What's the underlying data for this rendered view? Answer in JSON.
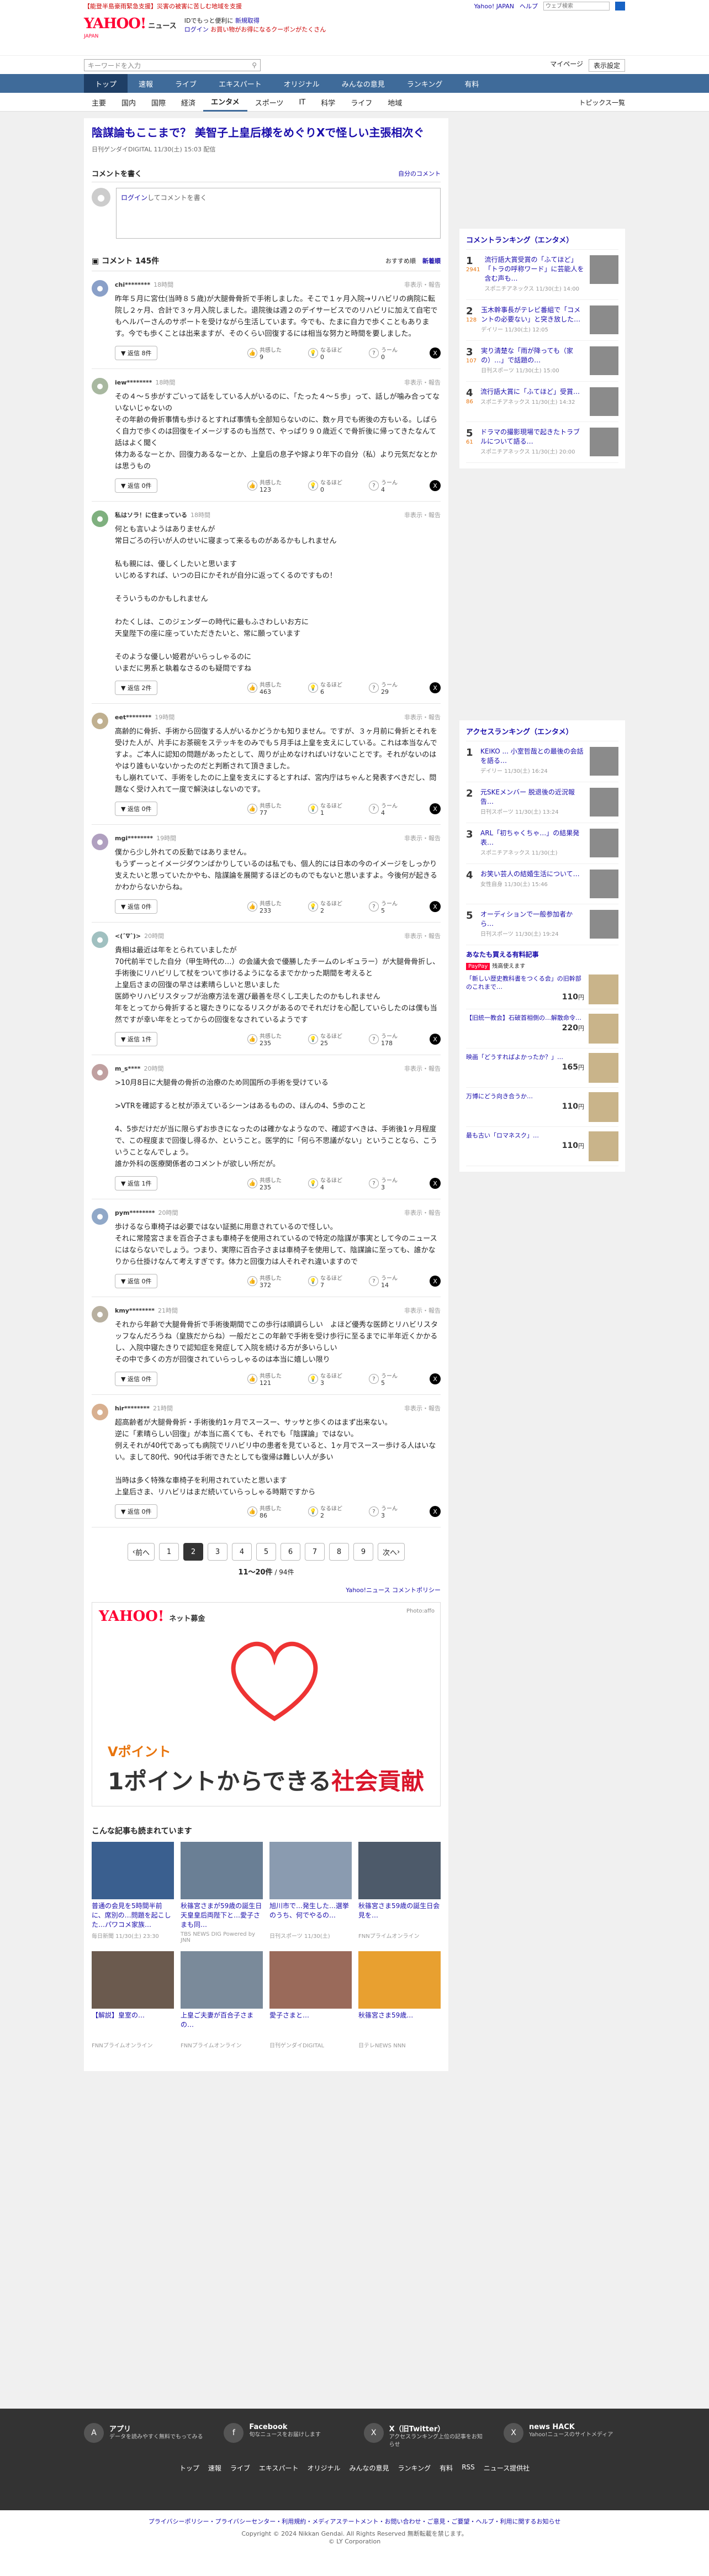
{
  "topbar": {
    "alert": "【能登半島豪雨緊急支援】災害の被害に苦しむ地域を支援",
    "yj": "Yahoo! JAPAN",
    "help": "ヘルプ",
    "search_placeholder": "ウェブ検索"
  },
  "header": {
    "logo": "YAHOO!",
    "logo_news": "ニュース",
    "logo_sub": "JAPAN",
    "promo1": "IDでもっと便利に",
    "promo1_link": "新規取得",
    "promo2": "ログイン",
    "promo2_rest": "お買い物がお得になるクーポンがたくさん"
  },
  "searchrow": {
    "placeholder": "キーワードを入力",
    "mypage": "マイページ",
    "settings": "表示設定"
  },
  "nav": [
    "トップ",
    "速報",
    "ライブ",
    "エキスパート",
    "オリジナル",
    "みんなの意見",
    "ランキング",
    "有料"
  ],
  "subnav": [
    "主要",
    "国内",
    "国際",
    "経済",
    "エンタメ",
    "スポーツ",
    "IT",
    "科学",
    "ライフ",
    "地域"
  ],
  "subnav_right": "トピックス一覧",
  "article": {
    "title": "陰謀論もここまで？ 美智子上皇后様をめぐりXで怪しい主張相次ぐ",
    "meta": "日刊ゲンダイDIGITAL 11/30(土) 15:03 配信"
  },
  "write": {
    "title": "コメントを書く",
    "my_comments": "自分のコメント",
    "login": "ログイン",
    "prompt": "してコメントを書く"
  },
  "comments_head": {
    "title": "コメント 145件",
    "sort_rec": "おすすめ順",
    "sort_new": "新着順"
  },
  "comments": [
    {
      "name": "chi********",
      "time": "18時間",
      "report": "非表示・報告",
      "text": "昨年５月に宮仕(当時８５歳)が大腿骨骨折で手術しました。そこで１ヶ月入院→リハビリの病院に転院し２ヶ月、合計で３ヶ月入院しました。退院後は週２のデイサービスでのリハビリに加えて自宅でもヘルパーさんのサポートを受けながら生活しています。今でも、たまに自力で歩くこともあります。今でも歩くことは出来ますが、そのくらい回復するには相当な努力と時間を要しました。",
      "like": "9",
      "agree": "0",
      "hmm": "0",
      "reply": "返信 8件"
    },
    {
      "name": "iew********",
      "time": "18時間",
      "report": "非表示・報告",
      "text": "その４〜５歩がすごいって話をしている人がいるのに、「たった４〜５歩」って、話しが噛み合ってないないじゃないの\nその年齢の骨折事情も歩けるとすれば事情も全部知らないのに、数ヶ月でも術後の方もいる。しばらく自力で歩くのは回復をイメージするのも当然で、やっぱり９０歳近くで骨折後に帰ってきたなんて話はよく聞く\n体力あるなーとか、回復力あるなーとか、上皇后の息子や嫁より年下の自分（私）より元気だなとかは思うもの",
      "like": "123",
      "agree": "0",
      "hmm": "4",
      "reply": "返信 0件"
    },
    {
      "name": "私はソラ！に住まっている",
      "time": "18時間",
      "report": "非表示・報告",
      "text": "何とも言いようはありませんが\n常日ごろの行いが人のせいに寝まって来るものがあるかもしれません\n\n私も親には、優しくしたいと思います\nいじめるすれば、いつの日にかそれが自分に返ってくるのですもの！\n\nそういうものかもしれません\n\nわたくしは、このジェンダーの時代に最もふさわしいお方に\n天皇陛下の座に座っていただきたいと、常に願っています\n\nそのような優しい姫君がいらっしゃるのに\nいまだに男系と執着なさるのも疑問ですね",
      "like": "463",
      "agree": "6",
      "hmm": "29",
      "reply": "返信 2件"
    },
    {
      "name": "eet********",
      "time": "19時間",
      "report": "非表示・報告",
      "text": "高齢的に骨折、手術から回復する人がいるかどうかも知りません。ですが、３ヶ月前に骨折とそれを受けた人が、片手にお茶碗をステッキをのみでも５月手は上皇を支えにしている。これは本当なんですよ。ご本人に認知の問題があったとして、周りが止めなければいけないことです。それがないのはやはり誰もいないかったのだと判断されて頂きました。\nもし崩れていて、手術をしたのに上皇を支えにするとすれば、宮内庁はちゃんと発表すべきだし、問題なく受け入れて一度で解決はしないのです。",
      "like": "77",
      "agree": "1",
      "hmm": "4",
      "reply": "返信 0件"
    },
    {
      "name": "mgi********",
      "time": "19時間",
      "report": "非表示・報告",
      "text": "僕から少し外れての反動ではありません。\nもうずーっとイメージダウンばかりしているのは私でも、個人的には日本の今のイメージをしっかり支えたいと思っていたかやも、陰謀論を展開するほどのものでもないと思いますよ。今後何が起きるかわからないからね。",
      "like": "233",
      "agree": "2",
      "hmm": "5",
      "reply": "返信 0件"
    },
    {
      "name": "<(ˆ∇ˆ)>",
      "time": "20時間",
      "report": "非表示・報告",
      "text": "貴相は最近は年をとられていましたが\n70代前半でした自分（甲生時代の…）の会議大会で優勝したチームのレギュラー）が大腿骨骨折し、手術後にリハビリして杖をついて歩けるようになるまでかかった期間を考えると\n上皇后さまの回復の早さは素晴らしいと思いました\n医師やリハビリスタッフが治療方法を選び最善を尽くし工夫したのかもしれません\n年をとってから骨折すると寝たきりになるリスクがあるのでそれだけを心配していらしたのは僕も当然ですが幸い年をとってからの回復をなされているようです",
      "like": "235",
      "agree": "25",
      "hmm": "178",
      "reply": "返信 1件"
    },
    {
      "name": "m_s****",
      "time": "20時間",
      "report": "非表示・報告",
      "text": ">10月8日に大腿骨の骨折の治療のため同国所の手術を受けている\n\n>VTRを確認すると杖が添えているシーンはあるものの、ほんの4、5歩のこと\n\n4、5歩だけだが当に限らずお歩きになったのは確かなようなので、確認すべきは、手術後1ヶ月程度で、この程度まで回復し得るか、ということ。医学的に「何ら不思議がない」ということなら、こういうことなんでしょう。\n誰か外科の医療関係者のコメントが欲しい所だが。",
      "like": "235",
      "agree": "4",
      "hmm": "3",
      "reply": "返信 1件"
    },
    {
      "name": "pym********",
      "time": "20時間",
      "report": "非表示・報告",
      "text": "歩けるなら車椅子は必要ではない証拠に用意されているので怪しい。\nそれに常陸宮さまを百合子さまも車椅子を使用されているので特定の陰謀が事実として今のニュースにはならないでしょう。つまり、実際に百合子さまは車椅子を使用して、陰謀論に至っても、誰かなりから仕掛けなんて考えすぎです。体力と回復力は人それぞれ違いますので",
      "like": "372",
      "agree": "7",
      "hmm": "14",
      "reply": "返信 0件"
    },
    {
      "name": "kmy********",
      "time": "21時間",
      "report": "非表示・報告",
      "text": "それから年齢で大腿骨骨折で手術後期間でこの歩行は順調らしい　よほど優秀な医師とリハビリスタッフなんだろうね（皇族だからね）一般だとこの年齢で手術を受け歩行に至るまでに半年近くかかるし、入院中寝たきりで認知症を発症して入院を続ける方が多いらしい\nその中で多くの方が回復されていらっしゃるのは本当に嬉しい限り",
      "like": "121",
      "agree": "3",
      "hmm": "5",
      "reply": "返信 0件"
    },
    {
      "name": "hir********",
      "time": "21時間",
      "report": "非表示・報告",
      "text": "超高齢者が大腿骨骨折・手術後約1ヶ月でスースー、サッサと歩くのはまず出来ない。\n逆に「素晴らしい回復」が本当に高くても、それでも「陰謀論」ではない。\n例えそれが40代であっても病院でリハビリ中の患者を見ていると、1ヶ月でスースー歩ける人はいない。まして80代、90代は手術できたとしても復帰は難しい人が多い\n\n当時は多く特殊な車椅子を利用されていたと思います\n上皇后さま、リハビリはまだ続いていらっしゃる時期ですから",
      "like": "86",
      "agree": "2",
      "hmm": "3",
      "reply": "返信 0件"
    }
  ],
  "pager": {
    "prev": "前へ",
    "pages": [
      "1",
      "2",
      "3",
      "4",
      "5",
      "6",
      "7",
      "8",
      "9"
    ],
    "current": "2",
    "next": "次へ",
    "info_range": "11〜20件",
    "info_total": "/ 94件"
  },
  "report_link": "Yahoo!ニュース コメントポリシー",
  "ad": {
    "brand": "YAHOO!",
    "brand_sub": "ネット募金",
    "credit": "Photo:affo",
    "line1": "Vポイント",
    "big_a": "1ポイントからできる",
    "big_b": "社会貢献"
  },
  "also": {
    "title": "こんな記事も読まれています",
    "items": [
      {
        "t": "普通の会見を5時間半前に、席別の…問題を起こした…パワコメ家族…",
        "s": "毎日新聞 11/30(土) 23:30"
      },
      {
        "t": "秋篠宮さまが59歳の誕生日 天皇皇后両陛下と…愛子さまも同…",
        "s": "TBS NEWS DIG Powered by JNN"
      },
      {
        "t": "旭川市で…発生した…選挙のうち、何でやるの…",
        "s": "日刊スポーツ 11/30(土)"
      },
      {
        "t": "秋篠宮さま59歳の誕生日会見を…",
        "s": "FNNプライムオンライン"
      },
      {
        "t": "【解説】皇室の…",
        "s": "FNNプライムオンライン"
      },
      {
        "t": "上皇ご夫妻が百合子さまの…",
        "s": "FNNプライムオンライン"
      },
      {
        "t": "愛子さまと…",
        "s": "日刊ゲンダイDIGITAL"
      },
      {
        "t": "秋篠宮さま59歳…",
        "s": "日テレNEWS NNN"
      }
    ]
  },
  "comment_rank": {
    "title": "コメントランキング（エンタメ）",
    "items": [
      {
        "no": "1",
        "cnt": "2941",
        "t": "流行語大賞受賞の「ふてほど」「トラの呼称ワード」に芸能人を含む声も…",
        "s": "スポニチアネックス 11/30(土) 14:00"
      },
      {
        "no": "2",
        "cnt": "128",
        "t": "玉木幹事長がテレビ番組で「コメントの必要ない」と突き放した…",
        "s": "デイリー 11/30(土) 12:05"
      },
      {
        "no": "3",
        "cnt": "107",
        "t": "実り清楚な「雨が降っても（家の）…」で話題の…",
        "s": "日刊スポーツ 11/30(土) 15:00"
      },
      {
        "no": "4",
        "cnt": "86",
        "t": "流行語大賞に「ふてほど」受賞…",
        "s": "スポニチアネックス 11/30(土) 14:32"
      },
      {
        "no": "5",
        "cnt": "61",
        "t": "ドラマの撮影現場で起きたトラブルについて語る…",
        "s": "スポニチアネックス 11/30(土) 20:00"
      }
    ]
  },
  "access_rank": {
    "title": "アクセスランキング（エンタメ）",
    "items": [
      {
        "no": "1",
        "t": "KEIKO ... 小室哲哉との最後の会話を語る…",
        "s": "デイリー 11/30(土) 16:24"
      },
      {
        "no": "2",
        "t": "元SKEメンバー 脱退後の近況報告…",
        "s": "日刊スポーツ 11/30(土) 13:24"
      },
      {
        "no": "3",
        "t": "ARL「初ちゃくちゃ…」の結果発表…",
        "s": "スポニチアネックス 11/30(土)"
      },
      {
        "no": "4",
        "t": "お笑い芸人の結婚生活について…",
        "s": "女性自身 11/30(土) 15:46"
      },
      {
        "no": "5",
        "t": "オーディションで一般参加者から…",
        "s": "日刊スポーツ 11/30(土) 19:24"
      }
    ]
  },
  "shop": {
    "title": "あなたも買える有料記事",
    "badge": "PayPay",
    "badge_text": "残高使えます",
    "items": [
      {
        "t": "「新しい歴史教科書をつくる会」の旧幹部のこれまで…",
        "p": "110"
      },
      {
        "t": "【旧統一教会】石破首相側の…解散命令…",
        "p": "220"
      },
      {
        "t": "映画「どうすればよかったか？」…",
        "p": "165"
      },
      {
        "t": "万博にどう向き合うか…",
        "p": "110"
      },
      {
        "t": "最も古い「ロマネスク」…",
        "p": "110"
      }
    ]
  },
  "footer": {
    "cols": [
      {
        "ic": "A",
        "t": "アプリ",
        "d": "データを読みやすく無料でもってみる"
      },
      {
        "ic": "f",
        "t": "Facebook",
        "d": "旬なニュースをお届けします"
      },
      {
        "ic": "X",
        "t": "X（旧Twitter）",
        "d": "アクセスランキング上位の記事をお知らせ"
      },
      {
        "ic": "X",
        "t": "news HACK",
        "d": "Yahoo!ニュースのサイトメディア"
      }
    ],
    "links": [
      "トップ",
      "速報",
      "ライブ",
      "エキスパート",
      "オリジナル",
      "みんなの意見",
      "ランキング",
      "有料",
      "RSS",
      "ニュース提供社"
    ]
  },
  "bottom": {
    "policy": "プライバシーポリシー・プライバシーセンター・利用規約・メディアステートメント・お問い合わせ・ご意見・ご要望・ヘルプ・利用に関するお知らせ",
    "copy1": "Copyright © 2024 Nikkan Gendai. All Rights Reserved 無断転載を禁じます。",
    "copy2": "© LY Corporation"
  }
}
